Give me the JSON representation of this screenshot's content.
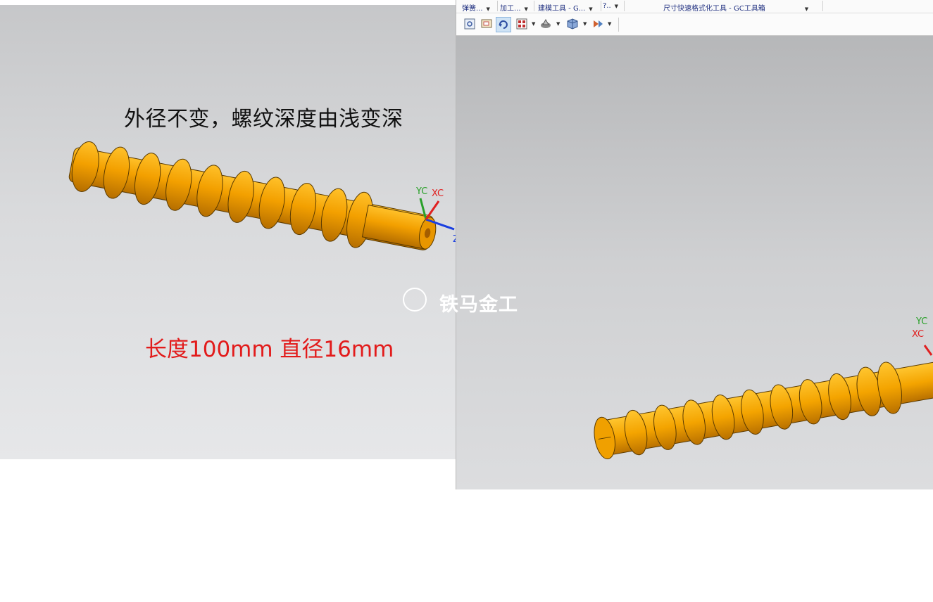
{
  "left_view": {
    "title": "外径不变，螺纹深度由浅变深",
    "spec": "长度100mm 直径16mm",
    "axis_labels": {
      "yc": "YC",
      "xc": "XC",
      "zc": "Z"
    }
  },
  "toolbar": {
    "groups": [
      {
        "label": "弹簧..."
      },
      {
        "label": "加工..."
      },
      {
        "label": "建模工具 - G..."
      },
      {
        "label": "?.."
      },
      {
        "label": "尺寸快速格式化工具 - GC工具箱"
      }
    ],
    "icons": [
      "fit-view-icon",
      "zoom-window-icon",
      "rotate-icon",
      "layout-icon",
      "shaded-icon",
      "cube-view-icon",
      "render-style-icon"
    ]
  },
  "right_view": {
    "axis_labels": {
      "yc": "YC",
      "xc": "XC"
    }
  },
  "watermark": {
    "text": "铁马金工"
  },
  "colors": {
    "part": "#f5a300",
    "spec_text": "#e21b1b",
    "title_text": "#111111"
  }
}
